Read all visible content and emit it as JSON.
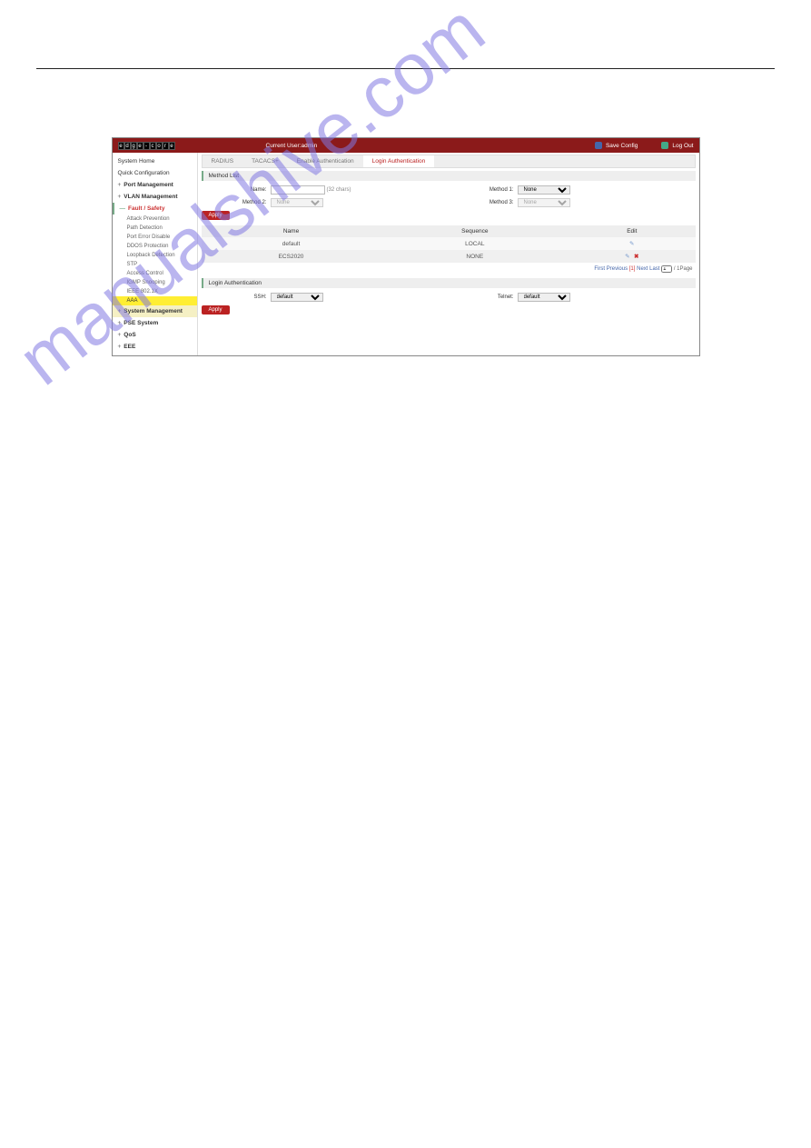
{
  "header": {
    "brand_chars": [
      "e",
      "d",
      "g",
      "e",
      "-",
      "c",
      "o",
      "r",
      "e"
    ],
    "current_user_label": "Current User:admin",
    "save_label": "Save Config",
    "logout_label": "Log Out"
  },
  "sidebar": {
    "items": [
      {
        "label": "System Home",
        "type": "plain"
      },
      {
        "label": "Quick Configuration",
        "type": "plain"
      },
      {
        "label": "Port Management",
        "type": "heading"
      },
      {
        "label": "VLAN Management",
        "type": "heading"
      },
      {
        "label": "Fault / Safety",
        "type": "expanded"
      }
    ],
    "sub_items": [
      {
        "label": "Attack Prevention"
      },
      {
        "label": "Path Detection"
      },
      {
        "label": "Port Error Disable"
      },
      {
        "label": "DDOS Protection"
      },
      {
        "label": "Loopback Detection"
      },
      {
        "label": "STP"
      },
      {
        "label": "Access Control"
      },
      {
        "label": "IGMP Snooping"
      },
      {
        "label": "IEEE 802.1X"
      },
      {
        "label": "AAA",
        "selected": true
      }
    ],
    "bottom_items": [
      {
        "label": "System Management",
        "highlight": true
      },
      {
        "label": "PSE System"
      },
      {
        "label": "QoS"
      },
      {
        "label": "EEE"
      }
    ]
  },
  "tabs": [
    {
      "label": "RADIUS"
    },
    {
      "label": "TACACS+"
    },
    {
      "label": "Enable Authentication"
    },
    {
      "label": "Login Authentication",
      "active": true
    }
  ],
  "section": {
    "method_list_title": "Method List",
    "login_auth_title": "Login Authentication"
  },
  "form": {
    "name_label": "Name:",
    "name_value": "",
    "name_hint": "(32 chars)",
    "method1_label": "Method 1:",
    "method1_value": "None",
    "method2_label": "Method 2:",
    "method2_value": "None",
    "method3_label": "Method 3:",
    "method3_value": "None",
    "apply_label": "Apply"
  },
  "table": {
    "headers": {
      "name": "Name",
      "sequence": "Sequence",
      "edit": "Edit"
    },
    "rows": [
      {
        "name": "default",
        "sequence": "LOCAL"
      },
      {
        "name": "ECS2020",
        "sequence": "NONE"
      }
    ]
  },
  "pager": {
    "first": "First",
    "previous": "Previous",
    "current": "[1]",
    "next": "Next",
    "last": "Last",
    "page_input": "1",
    "perpage": " / 1Page"
  },
  "login_auth": {
    "ssh_label": "SSH:",
    "ssh_value": "default",
    "telnet_label": "Telnet:",
    "telnet_value": "default",
    "apply_label": "Apply"
  },
  "watermark": "manualshive.com"
}
